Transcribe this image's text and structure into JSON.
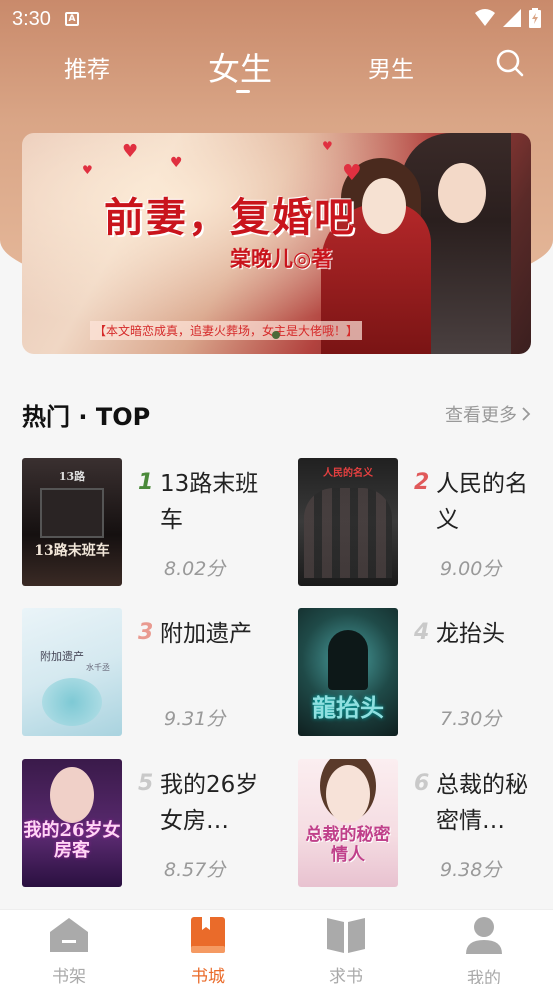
{
  "status_bar": {
    "time": "3:30",
    "notification_letter": "A"
  },
  "tabs": [
    {
      "label": "推荐",
      "active": false
    },
    {
      "label": "女生",
      "active": true
    },
    {
      "label": "男生",
      "active": false
    }
  ],
  "banner": {
    "title": "前妻，复婚吧",
    "author": "棠晚儿◎著",
    "tagline": "【本文暗恋成真，追妻火葬场，女主是大佬哦！】",
    "page_count": 2,
    "active_page": 1
  },
  "section": {
    "title": "热门 · TOP",
    "more_label": "查看更多"
  },
  "books": [
    {
      "rank": "1",
      "title": "13路末班车",
      "score": "8.02分",
      "rank_color": "#4b8a3a",
      "cover_text": "13路末班车",
      "cover_top": "13路"
    },
    {
      "rank": "2",
      "title": "人民的名义",
      "score": "9.00分",
      "rank_color": "#e0595a",
      "cover_text": "人民的名义"
    },
    {
      "rank": "3",
      "title": "附加遗产",
      "score": "9.31分",
      "rank_color": "#e99a90",
      "cover_text": "附加遗产",
      "cover_author": "水千丞"
    },
    {
      "rank": "4",
      "title": "龙抬头",
      "score": "7.30分",
      "rank_color": "#c9c9c9",
      "cover_text": "龍抬头"
    },
    {
      "rank": "5",
      "title": "我的26岁女房…",
      "score": "8.57分",
      "rank_color": "#c9c9c9",
      "cover_text": "我的26岁女房客"
    },
    {
      "rank": "6",
      "title": "总裁的秘密情…",
      "score": "9.38分",
      "rank_color": "#c9c9c9",
      "cover_text": "总裁的秘密情人"
    }
  ],
  "nav": [
    {
      "label": "书架",
      "icon": "home-icon",
      "active": false
    },
    {
      "label": "书城",
      "icon": "book-icon",
      "active": true
    },
    {
      "label": "求书",
      "icon": "open-book-icon",
      "active": false
    },
    {
      "label": "我的",
      "icon": "user-icon",
      "active": false
    }
  ],
  "colors": {
    "accent": "#ea6b2a",
    "header": "#d9a586"
  }
}
